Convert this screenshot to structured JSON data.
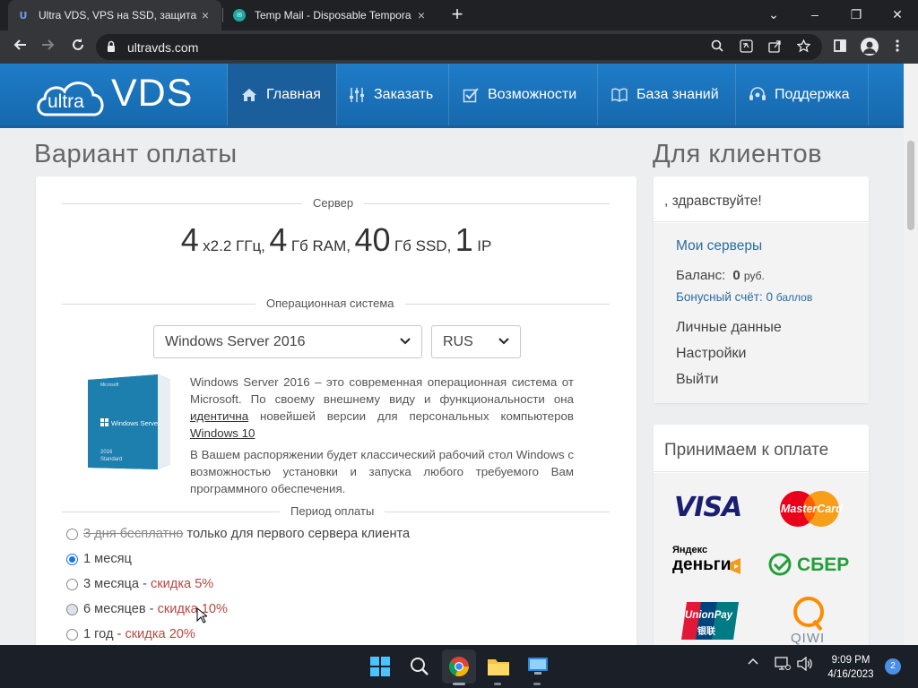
{
  "browser": {
    "tabs": [
      {
        "title": "Ultra VDS, VPS на SSD, защита о",
        "active": true
      },
      {
        "title": "Temp Mail - Disposable Tempora",
        "active": false
      }
    ],
    "url": "ultravds.com",
    "new_tab": "+",
    "close_tab": "×",
    "window_controls": {
      "dropdown": "⌄",
      "minimize": "–",
      "restore": "❐",
      "close": "✕"
    }
  },
  "site": {
    "logo": {
      "ultra": "ultra",
      "vds": "VDS"
    },
    "nav": [
      {
        "label": "Главная",
        "icon": "home-icon"
      },
      {
        "label": "Заказать",
        "icon": "sliders-icon"
      },
      {
        "label": "Возможности",
        "icon": "checkbox-icon"
      },
      {
        "label": "База знаний",
        "icon": "book-icon"
      },
      {
        "label": "Поддержка",
        "icon": "support-icon"
      }
    ]
  },
  "main": {
    "title": "Вариант оплаты",
    "server_section": "Сервер",
    "config": {
      "cpu_count": "4",
      "cpu_unit": "x2.2 ГГц,",
      "ram_value": "4",
      "ram_unit": "Гб RAM,",
      "ssd_value": "40",
      "ssd_unit": "Гб SSD,",
      "ip_value": "1",
      "ip_unit": "IP"
    },
    "os_section": "Операционная система",
    "os_select": "Windows Server 2016",
    "lang_select": "RUS",
    "os_box": {
      "brand": "Microsoft",
      "product": "Windows Server",
      "version": "2016",
      "edition": "Standard"
    },
    "os_description": {
      "p1_a": "Windows Server 2016 – это современная операционная система от Microsoft. По своему внешнему виду и функциональности она ",
      "p1_link": "идентична",
      "p1_b": " новейшей версии для персональных компьютеров ",
      "p1_link2": "Windows 10",
      "p2": "В Вашем распоряжении будет классический рабочий стол Windows с возможностью установки и запуска любого требуемого Вам программного обеспечения."
    },
    "period_section": "Период оплаты",
    "periods": [
      {
        "strike": "3 дня бесплатно",
        "text": " только для первого сервера клиента",
        "discount": "",
        "selected": false
      },
      {
        "strike": "",
        "text": "1 месяц",
        "discount": "",
        "selected": true
      },
      {
        "strike": "",
        "text": "3 месяца - ",
        "discount": "скидка 5%",
        "selected": false
      },
      {
        "strike": "",
        "text": "6 месяцев - ",
        "discount": "скидка 10%",
        "selected": false
      },
      {
        "strike": "",
        "text": "1 год - ",
        "discount": "скидка 20%",
        "selected": false
      }
    ]
  },
  "sidebar": {
    "title": "Для клиентов",
    "greeting": ", здравствуйте!",
    "my_servers": "Мои серверы",
    "balance_label": "Баланс:",
    "balance_value": "0",
    "balance_unit": "руб.",
    "bonus_label": "Бонусный счёт:",
    "bonus_value": "0",
    "bonus_unit": "баллов",
    "links": [
      "Личные данные",
      "Настройки",
      "Выйти"
    ],
    "payments_title": "Принимаем к оплате",
    "payments": {
      "visa": "VISA",
      "mastercard": "MasterCard",
      "yandex_top": "Яндекс",
      "yandex_bottom": "деньги",
      "sber": "СБЕР",
      "unionpay": "UnionPay",
      "unionpay_cn": "银联",
      "qiwi": "QIWI"
    }
  },
  "taskbar": {
    "time": "9:09 PM",
    "date": "4/16/2023",
    "notifications": "2"
  }
}
